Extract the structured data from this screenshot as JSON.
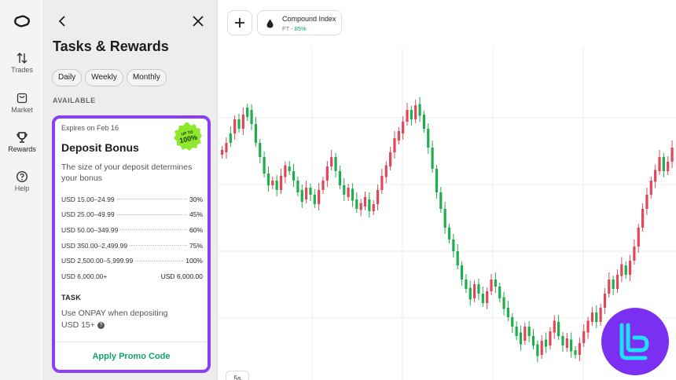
{
  "nav": {
    "items": [
      {
        "label": "Trades",
        "icon": "arrows-updown-icon"
      },
      {
        "label": "Market",
        "icon": "bag-icon"
      },
      {
        "label": "Rewards",
        "icon": "trophy-icon"
      },
      {
        "label": "Help",
        "icon": "help-icon"
      }
    ]
  },
  "panel": {
    "title": "Tasks & Rewards",
    "filters": [
      "Daily",
      "Weekly",
      "Monthly"
    ],
    "section_label": "AVAILABLE",
    "card": {
      "expires": "Expires on Feb 16",
      "badge_top": "UP TO",
      "badge_value": "100%",
      "title": "Deposit Bonus",
      "description": "The size of your deposit determines your bonus",
      "tiers": [
        {
          "range": "USD 15.00–24.99",
          "bonus": "30%"
        },
        {
          "range": "USD 25.00–49.99",
          "bonus": "45%"
        },
        {
          "range": "USD 50.00–349.99",
          "bonus": "60%"
        },
        {
          "range": "USD 350.00–2,499.99",
          "bonus": "75%"
        },
        {
          "range": "USD 2,500.00–5,999.99",
          "bonus": "100%"
        },
        {
          "range": "USD 6,000.00+",
          "bonus": "USD 6,000.00"
        }
      ],
      "task_label": "TASK",
      "task_text": "Use ONPAY when depositing USD 15+",
      "help_glyph": "?",
      "apply_label": "Apply Promo Code"
    }
  },
  "chart": {
    "add_glyph": "+",
    "asset_name": "Compound Index",
    "asset_code": "FT",
    "asset_sep": " - ",
    "asset_payout": "85%",
    "timeframe": "5s",
    "up_color": "#1fae4b",
    "down_color": "#e0475a",
    "candles": [
      [
        0,
        38,
        1
      ],
      [
        1,
        34,
        1
      ],
      [
        2,
        30,
        0
      ],
      [
        3,
        24,
        1
      ],
      [
        4,
        28,
        0
      ],
      [
        5,
        22,
        1
      ],
      [
        6,
        20,
        0
      ],
      [
        7,
        26,
        0
      ],
      [
        8,
        34,
        0
      ],
      [
        9,
        40,
        0
      ],
      [
        10,
        47,
        0
      ],
      [
        11,
        52,
        0
      ],
      [
        12,
        50,
        1
      ],
      [
        13,
        54,
        0
      ],
      [
        14,
        48,
        1
      ],
      [
        15,
        44,
        1
      ],
      [
        16,
        46,
        0
      ],
      [
        17,
        50,
        0
      ],
      [
        18,
        55,
        0
      ],
      [
        19,
        58,
        0
      ],
      [
        20,
        53,
        1
      ],
      [
        21,
        56,
        0
      ],
      [
        22,
        60,
        0
      ],
      [
        23,
        54,
        1
      ],
      [
        24,
        50,
        1
      ],
      [
        25,
        44,
        1
      ],
      [
        26,
        40,
        1
      ],
      [
        27,
        46,
        0
      ],
      [
        28,
        52,
        0
      ],
      [
        29,
        56,
        0
      ],
      [
        30,
        54,
        1
      ],
      [
        31,
        58,
        0
      ],
      [
        32,
        62,
        0
      ],
      [
        33,
        60,
        1
      ],
      [
        34,
        58,
        1
      ],
      [
        35,
        63,
        0
      ],
      [
        36,
        60,
        1
      ],
      [
        37,
        54,
        1
      ],
      [
        38,
        48,
        1
      ],
      [
        39,
        44,
        1
      ],
      [
        40,
        38,
        1
      ],
      [
        41,
        32,
        1
      ],
      [
        42,
        30,
        1
      ],
      [
        43,
        25,
        1
      ],
      [
        44,
        20,
        1
      ],
      [
        45,
        24,
        0
      ],
      [
        46,
        18,
        1
      ],
      [
        47,
        22,
        0
      ],
      [
        48,
        28,
        0
      ],
      [
        49,
        36,
        0
      ],
      [
        50,
        45,
        0
      ],
      [
        51,
        55,
        0
      ],
      [
        52,
        62,
        0
      ],
      [
        53,
        70,
        0
      ],
      [
        54,
        75,
        0
      ],
      [
        55,
        80,
        0
      ],
      [
        56,
        86,
        0
      ],
      [
        57,
        92,
        0
      ],
      [
        58,
        96,
        0
      ],
      [
        59,
        100,
        0
      ],
      [
        60,
        94,
        1
      ],
      [
        61,
        98,
        0
      ],
      [
        62,
        102,
        0
      ],
      [
        63,
        97,
        1
      ],
      [
        64,
        92,
        1
      ],
      [
        65,
        95,
        0
      ],
      [
        66,
        100,
        0
      ],
      [
        67,
        104,
        0
      ],
      [
        68,
        108,
        0
      ],
      [
        69,
        112,
        0
      ],
      [
        70,
        116,
        0
      ],
      [
        71,
        118,
        0
      ],
      [
        72,
        112,
        1
      ],
      [
        73,
        116,
        0
      ],
      [
        74,
        120,
        0
      ],
      [
        75,
        124,
        0
      ],
      [
        76,
        118,
        1
      ],
      [
        77,
        120,
        0
      ],
      [
        78,
        114,
        1
      ],
      [
        79,
        110,
        1
      ],
      [
        80,
        116,
        0
      ],
      [
        81,
        120,
        0
      ],
      [
        82,
        118,
        1
      ],
      [
        83,
        122,
        0
      ],
      [
        84,
        124,
        0
      ],
      [
        85,
        119,
        1
      ],
      [
        86,
        114,
        1
      ],
      [
        87,
        110,
        1
      ],
      [
        88,
        106,
        1
      ],
      [
        89,
        110,
        0
      ],
      [
        90,
        104,
        1
      ],
      [
        91,
        98,
        1
      ],
      [
        92,
        92,
        1
      ],
      [
        93,
        96,
        0
      ],
      [
        94,
        90,
        1
      ],
      [
        95,
        86,
        1
      ],
      [
        96,
        90,
        0
      ],
      [
        97,
        84,
        1
      ],
      [
        98,
        78,
        1
      ],
      [
        99,
        70,
        1
      ],
      [
        100,
        62,
        1
      ],
      [
        101,
        56,
        1
      ],
      [
        102,
        50,
        1
      ],
      [
        103,
        46,
        1
      ],
      [
        104,
        40,
        1
      ],
      [
        105,
        46,
        0
      ],
      [
        106,
        42,
        1
      ],
      [
        107,
        36,
        1
      ]
    ]
  }
}
